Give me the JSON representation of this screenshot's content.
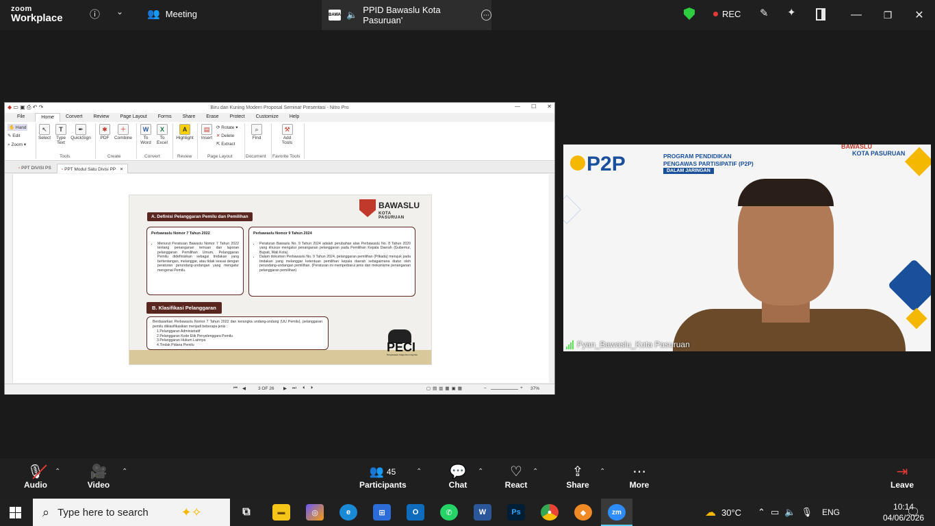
{
  "zoom": {
    "brand_top": "zoom",
    "brand_bottom": "Workplace",
    "meeting_tab": "Meeting",
    "share_tab": "PPID Bawaslu Kota Pasuruan'",
    "share_badge": "BAWA",
    "rec_label": "REC"
  },
  "nitro": {
    "window_title": "Biru dan Kuning Modern Proposal Seminar Presentasi - Nitro Pro",
    "menu": [
      "File",
      "Home",
      "Convert",
      "Review",
      "Page Layout",
      "Forms",
      "Share",
      "Erase",
      "Protect",
      "Customize",
      "Help"
    ],
    "ribbon": {
      "hand": "Hand",
      "edit": "Edit",
      "zoom": "Zoom",
      "select": "Select",
      "type_text": "Type Text",
      "quicksign": "QuickSign",
      "pdf": "PDF",
      "combine": "Combine",
      "to_word": "To Word",
      "to_excel": "To Excel",
      "highlight": "Highlight",
      "insert": "Insert",
      "rotate": "Rotate",
      "delete": "Delete",
      "extract": "Extract",
      "find": "Find",
      "add_tools": "Add Tools",
      "groups": [
        "Tools",
        "Create",
        "Convert",
        "Review",
        "Page Layout",
        "Document",
        "Favorite Tools"
      ]
    },
    "doc_tabs": [
      "PPT DIVISI PS",
      "PPT Modul Satu Divisi PP"
    ],
    "status": {
      "page": "3 OF 26",
      "zoom": "37%"
    }
  },
  "slide": {
    "logo_title": "BAWASLU",
    "logo_sub": "KOTA PASURUAN",
    "section_a": "A. Definisi Pelanggaran Pemilu dan Pemilihan",
    "box1_title": "Perbawaslu Nomor 7 Tahun 2022",
    "box1_text": "Menurut Peraturan Bawaslu Nomor 7 Tahun 2022 tentang penanganan temuan dan laporan pelanggaran Pemilihan Umum, Pelanggaran Pemilu didefinisikan sebagai tindakan yang bertentangan, melanggar, atau tidak sesuai dengan peraturan perundang-undangan yang mengatur mengenai Pemilu.",
    "box2_title": "Perbawaslu Nomor 9 Tahun 2024",
    "box2_item1": "Peraturan Bawaslu No. 9 Tahun 2024 adalah perubahan atas Perbawaslu No. 8 Tahun 2020 yang khusus mengatur penanganan pelanggaran pada Pemilihan Kepala Daerah (Gubernur, Bupati, Wali Kota).",
    "box2_item2": "Dalam dokumen Perbawaslu No. 9 Tahun 2024, pelanggaran pemilihan (Pilkada) merujuk pada tindakan yang melanggar ketentuan pemilihan kepala daerah sebagaimana diatur oleh perundang-undangan pemilihan. (Peraturan ini memperbarui jenis dan mekanisme penanganan pelanggaran pemilihan)",
    "section_b": "B. Klasifikasi Pelanggaran",
    "box3_intro": "Berdasarkan Perbawaslu Nomor 7 Tahun 2022 dan kerangka undang-undang (UU Pemilu), pelanggaran pemilu diklasifikasikan menjadi beberapa jenis :",
    "box3_items": [
      "1.Pelanggaran Administratif",
      "2.Pelanggaran Kode Etik Penyelenggara Pemilu",
      "3.Pelanggaran Hukum Lainnya",
      "4.Tindak Pidana Pemilu"
    ],
    "peci": "PECI",
    "peci_sub": "Pengawasan Siaga dan Integritas"
  },
  "video": {
    "p2p": "P2P",
    "program_line1": "PROGRAM PENDIDIKAN",
    "program_line2": "PENGAWAS PARTISIPATIF (P2P)",
    "dalam_jaringan": "DALAM JARINGAN",
    "corner_logo": "BAWASLU",
    "corner_sub": "KOTA PASURUAN",
    "participant_name": "Fyan_Bawaslu_Kota Pasuruan"
  },
  "toolbar": {
    "audio": "Audio",
    "video": "Video",
    "participants": "Participants",
    "participants_count": "45",
    "chat": "Chat",
    "react": "React",
    "share": "Share",
    "more": "More",
    "leave": "Leave"
  },
  "taskbar": {
    "search_placeholder": "Type here to search",
    "temperature": "30°C",
    "language": "ENG",
    "time": "10:14",
    "date": "04/06/2026"
  }
}
